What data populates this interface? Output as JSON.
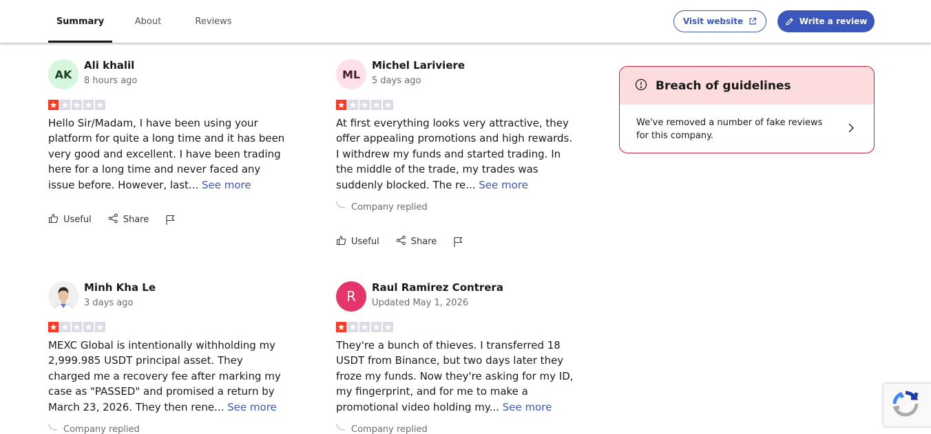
{
  "nav": {
    "tabs": [
      {
        "label": "Summary",
        "active": true
      },
      {
        "label": "About",
        "active": false
      },
      {
        "label": "Reviews",
        "active": false
      }
    ],
    "visit_website": "Visit website",
    "write_review": "Write a review"
  },
  "colors": {
    "accent": "#3c57bc",
    "star_filled": "#ff3722",
    "star_empty": "#dcdce6",
    "breach_border": "#c6213a",
    "breach_bg": "#fcdcdc"
  },
  "reviews": [
    {
      "initials": "AK",
      "name": "Ali khalil",
      "date": "8 hours ago",
      "rating": 1,
      "text": "Hello Sir/Madam, I have been using your platform for quite a long time and it has been very good and excellent. I have been trading here for a long time and never faced any issue before. However, last...",
      "see_more": "See more",
      "actions": {
        "useful": "Useful",
        "share": "Share"
      }
    },
    {
      "initials": "ML",
      "name": "Michel Lariviere",
      "date": "5 days ago",
      "rating": 1,
      "text": "At first everything looks very attractive, they offer appealing promotions and high rewards. I withdrew my funds and started trading. In the middle of the trade, my trades was suddenly blocked. The re...",
      "see_more": "See more",
      "company_replied": "Company replied",
      "actions": {
        "useful": "Useful",
        "share": "Share"
      }
    },
    {
      "initials": "",
      "avatar_icon": "user-photo",
      "name": "Minh Kha Le",
      "date": "3 days ago",
      "rating": 1,
      "text": "MEXC Global is intentionally withholding my 2,999.985 USDT principal asset. They charged me a recovery fee after marking my case as \"PASSED\" and promised a return by March 23, 2026. They then rene...",
      "see_more": "See more",
      "company_replied": "Company replied"
    },
    {
      "initials": "R",
      "name": "Raul Ramirez Contrera",
      "date": "Updated May 1, 2026",
      "rating": 1,
      "text": "They're a bunch of thieves. I transferred 18 USDT from Binance, but two days later they froze my funds. Now they're asking for my ID, my fingerprint, and for me to make a promotional video holding my...",
      "see_more": "See more",
      "company_replied": "Company replied"
    }
  ],
  "breach": {
    "title": "Breach of guidelines",
    "message": "We've removed a number of fake reviews for this company."
  }
}
